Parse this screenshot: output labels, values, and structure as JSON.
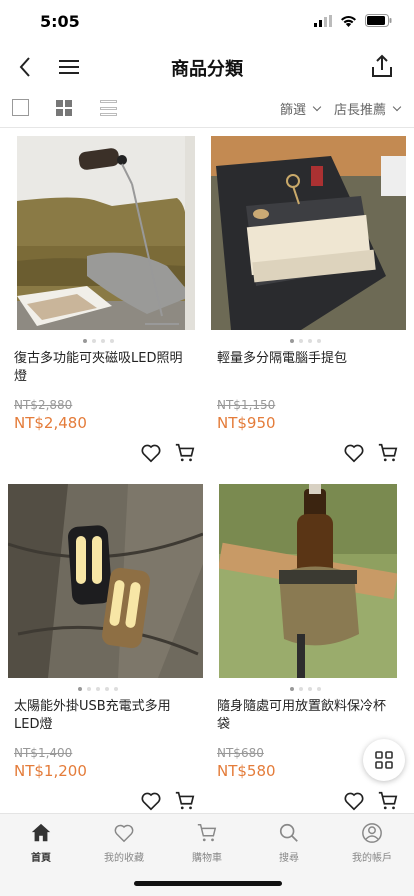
{
  "status_bar": {
    "time": "5:05"
  },
  "nav": {
    "title": "商品分類"
  },
  "toolbar": {
    "filter_label": "篩選",
    "sort_label": "店長推薦"
  },
  "products": [
    {
      "name": "復古多功能可夾磁吸LED照明燈",
      "original_price": "NT$2,880",
      "price": "NT$2,480"
    },
    {
      "name": "輕量多分隔電腦手提包",
      "original_price": "NT$1,150",
      "price": "NT$950"
    },
    {
      "name": "太陽能外掛USB充電式多用LED燈",
      "original_price": "NT$1,400",
      "price": "NT$1,200"
    },
    {
      "name": "隨身隨處可用放置飲料保冷杯袋",
      "original_price": "NT$680",
      "price": "NT$580"
    }
  ],
  "tabbar": {
    "items": [
      {
        "label": "首頁",
        "icon": "home-icon",
        "active": true
      },
      {
        "label": "我的收藏",
        "icon": "heart-icon",
        "active": false
      },
      {
        "label": "購物車",
        "icon": "cart-icon",
        "active": false
      },
      {
        "label": "搜尋",
        "icon": "search-icon",
        "active": false
      },
      {
        "label": "我的帳戶",
        "icon": "account-icon",
        "active": false
      }
    ]
  },
  "colors": {
    "price": "#e47c3a",
    "tabbar_bg": "#f5f5f5"
  }
}
